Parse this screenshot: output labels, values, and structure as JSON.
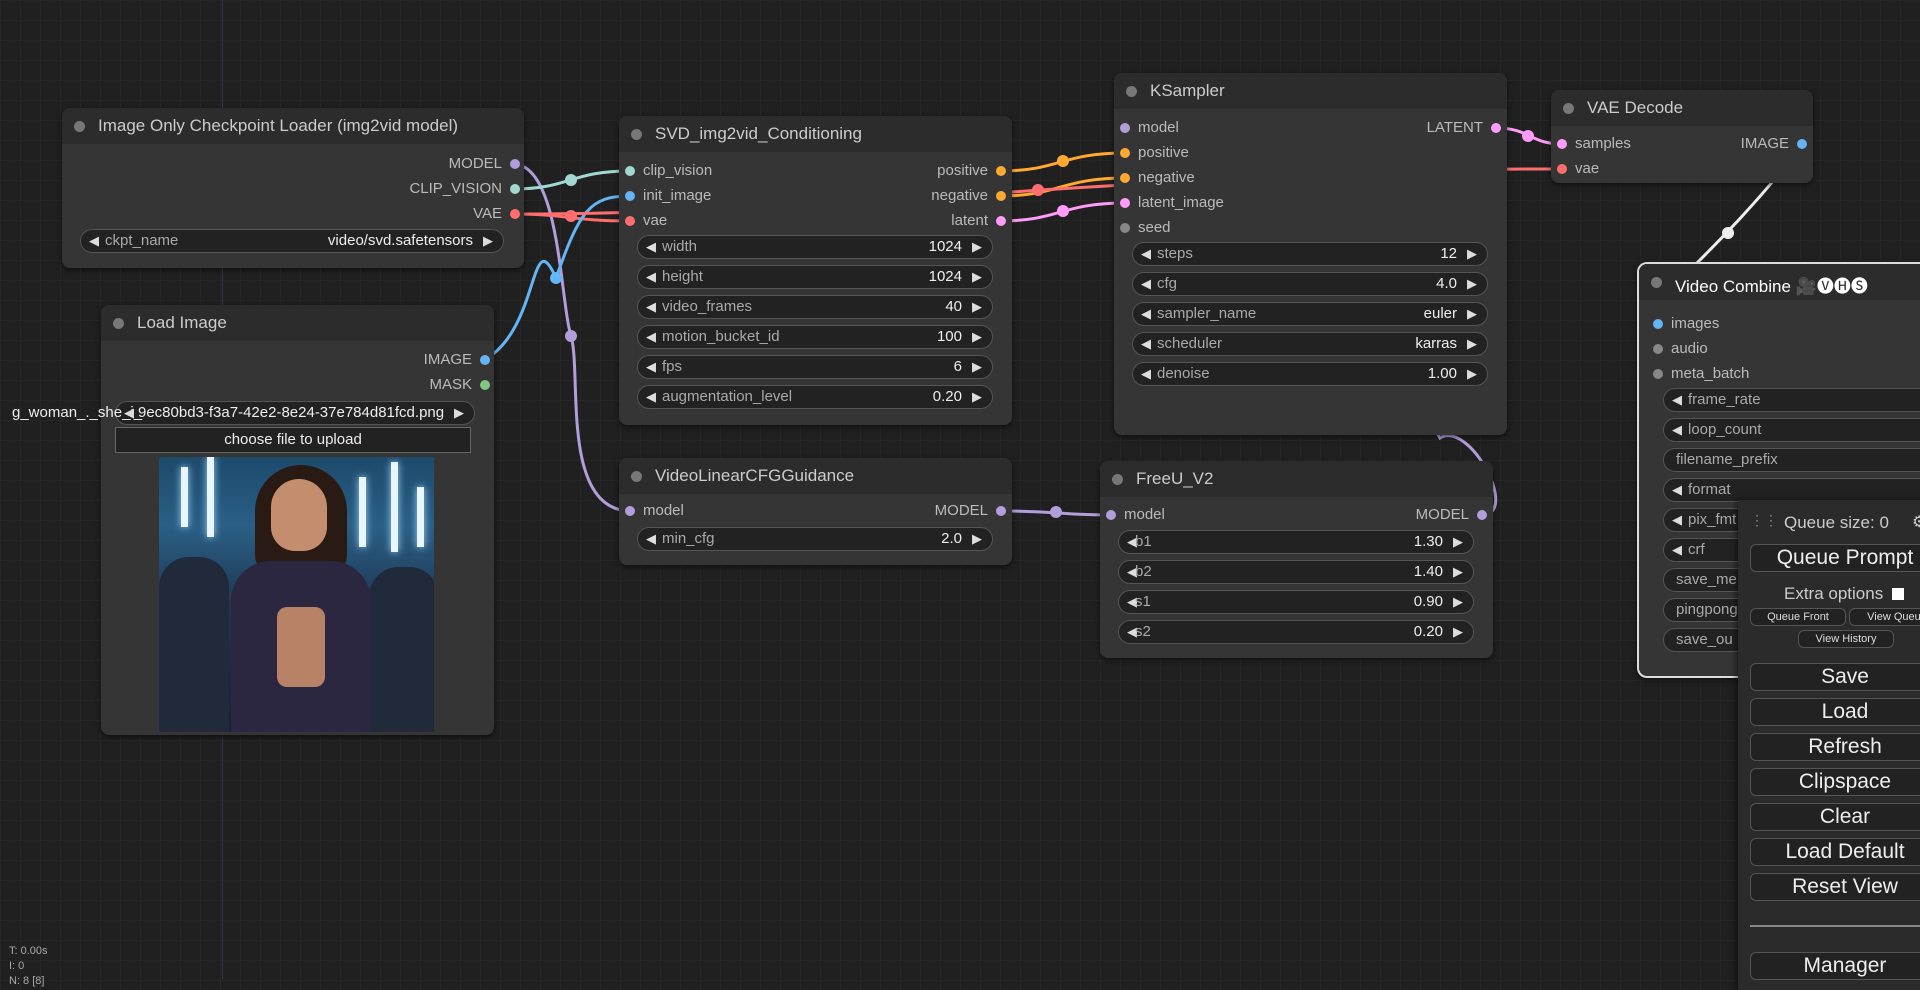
{
  "nodes": {
    "checkpoint_loader": {
      "title": "Image Only Checkpoint Loader (img2vid model)",
      "outputs": [
        "MODEL",
        "CLIP_VISION",
        "VAE"
      ],
      "widget": {
        "name": "ckpt_name",
        "value": "video/svd.safetensors"
      }
    },
    "load_image": {
      "title": "Load Image",
      "outputs": [
        "IMAGE",
        "MASK"
      ],
      "widget": {
        "name": "g_woman_._she_i_",
        "value": "9ec80bd3-f3a7-42e2-8e24-37e784d81fcd.png"
      },
      "upload_label": "choose file to upload"
    },
    "svd_conditioning": {
      "title": "SVD_img2vid_Conditioning",
      "inputs": [
        "clip_vision",
        "init_image",
        "vae"
      ],
      "outputs": [
        "positive",
        "negative",
        "latent"
      ],
      "widgets": [
        {
          "name": "width",
          "value": "1024"
        },
        {
          "name": "height",
          "value": "1024"
        },
        {
          "name": "video_frames",
          "value": "40"
        },
        {
          "name": "motion_bucket_id",
          "value": "100"
        },
        {
          "name": "fps",
          "value": "6"
        },
        {
          "name": "augmentation_level",
          "value": "0.20"
        }
      ]
    },
    "linear_cfg": {
      "title": "VideoLinearCFGGuidance",
      "input": "model",
      "output": "MODEL",
      "widget": {
        "name": "min_cfg",
        "value": "2.0"
      }
    },
    "ksampler": {
      "title": "KSampler",
      "inputs": [
        "model",
        "positive",
        "negative",
        "latent_image",
        "seed"
      ],
      "output": "LATENT",
      "widgets": [
        {
          "name": "steps",
          "value": "12"
        },
        {
          "name": "cfg",
          "value": "4.0"
        },
        {
          "name": "sampler_name",
          "value": "euler"
        },
        {
          "name": "scheduler",
          "value": "karras"
        },
        {
          "name": "denoise",
          "value": "1.00"
        }
      ]
    },
    "freeu": {
      "title": "FreeU_V2",
      "input": "model",
      "output": "MODEL",
      "widgets": [
        {
          "name": "b1",
          "value": "1.30"
        },
        {
          "name": "b2",
          "value": "1.40"
        },
        {
          "name": "s1",
          "value": "0.90"
        },
        {
          "name": "s2",
          "value": "0.20"
        }
      ]
    },
    "vae_decode": {
      "title": "VAE Decode",
      "inputs": [
        "samples",
        "vae"
      ],
      "output": "IMAGE"
    },
    "video_combine": {
      "title": "Video Combine 🎥🅥🅗🅢",
      "inputs": [
        "images",
        "audio",
        "meta_batch"
      ],
      "widgets": [
        "frame_rate",
        "loop_count",
        "filename_prefix",
        "format",
        "pix_fmt",
        "crf",
        "save_me",
        "pingpong",
        "save_ou"
      ]
    }
  },
  "queue_panel": {
    "size_label": "Queue size: 0",
    "queue_prompt": "Queue Prompt",
    "extra_options": "Extra options",
    "queue_front": "Queue Front",
    "view_queue": "View Queue",
    "view_history": "View History",
    "buttons": [
      "Save",
      "Load",
      "Refresh",
      "Clipspace",
      "Clear",
      "Load Default",
      "Reset View"
    ],
    "manager": "Manager"
  },
  "stats": {
    "t": "T: 0.00s",
    "i": "I: 0",
    "n": "N: 8 [8]"
  },
  "colors": {
    "model": "#b39ddb",
    "clip_vision": "#a1d9d2",
    "vae": "#ff6e6e",
    "image": "#64b5f6",
    "mask": "#81c784",
    "conditioning": "#ffa931",
    "latent": "#ff9cf9",
    "int": "#888888"
  }
}
